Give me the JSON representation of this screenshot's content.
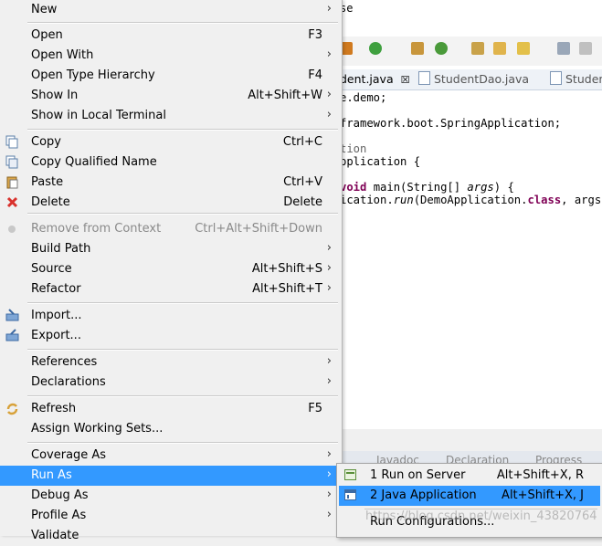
{
  "editor": {
    "partial_text_top": "se",
    "tabs": [
      {
        "label": "dent.java",
        "close": "☒"
      },
      {
        "label": "StudentDao.java"
      },
      {
        "label": "Studen"
      }
    ],
    "code_lines": [
      {
        "segs": [
          {
            "t": "e.demo;"
          }
        ]
      },
      {
        "segs": [
          {
            "t": "framework.boot.SpringApplication;"
          }
        ]
      },
      {
        "segs": [
          {
            "t": "tion",
            "c": "an"
          }
        ]
      },
      {
        "segs": [
          {
            "t": "pplication {"
          }
        ]
      },
      {
        "segs": [
          {
            "t": "void",
            "c": "kw"
          },
          {
            "t": " main(String[] "
          },
          {
            "t": "args",
            "c": "it"
          },
          {
            "t": ") {"
          }
        ]
      },
      {
        "segs": [
          {
            "t": "ication."
          },
          {
            "t": "run",
            "c": "it"
          },
          {
            "t": "(DemoApplication."
          },
          {
            "t": "class",
            "c": "kw"
          },
          {
            "t": ", args);"
          }
        ]
      }
    ],
    "bottom_tabs": [
      "Javadoc",
      "Declaration",
      "Progress"
    ]
  },
  "menu": {
    "items": [
      {
        "label": "New",
        "submenu": true
      },
      {
        "label": "Open",
        "shortcut": "F3"
      },
      {
        "label": "Open With",
        "submenu": true
      },
      {
        "label": "Open Type Hierarchy",
        "shortcut": "F4"
      },
      {
        "label": "Show In",
        "shortcut": "Alt+Shift+W",
        "submenu": true
      },
      {
        "label": "Show in Local Terminal",
        "submenu": true
      },
      {
        "label": "Copy",
        "shortcut": "Ctrl+C",
        "icon": "copy-icon"
      },
      {
        "label": "Copy Qualified Name",
        "icon": "copy-qualified-icon"
      },
      {
        "label": "Paste",
        "shortcut": "Ctrl+V",
        "icon": "paste-icon"
      },
      {
        "label": "Delete",
        "shortcut": "Delete",
        "icon": "delete-icon"
      },
      {
        "label": "Remove from Context",
        "shortcut": "Ctrl+Alt+Shift+Down",
        "disabled": true,
        "icon": "remove-context-icon"
      },
      {
        "label": "Build Path",
        "submenu": true
      },
      {
        "label": "Source",
        "shortcut": "Alt+Shift+S",
        "submenu": true
      },
      {
        "label": "Refactor",
        "shortcut": "Alt+Shift+T",
        "submenu": true
      },
      {
        "label": "Import...",
        "icon": "import-icon"
      },
      {
        "label": "Export...",
        "icon": "export-icon"
      },
      {
        "label": "References",
        "submenu": true
      },
      {
        "label": "Declarations",
        "submenu": true
      },
      {
        "label": "Refresh",
        "shortcut": "F5",
        "icon": "refresh-icon"
      },
      {
        "label": "Assign Working Sets..."
      },
      {
        "label": "Coverage As",
        "submenu": true
      },
      {
        "label": "Run As",
        "submenu": true,
        "selected": true
      },
      {
        "label": "Debug As",
        "submenu": true
      },
      {
        "label": "Profile As",
        "submenu": true
      },
      {
        "label": "Validate"
      }
    ],
    "submenu_arrow": "›"
  },
  "run_as_submenu": {
    "items": [
      {
        "label": "1 Run on Server",
        "shortcut": "Alt+Shift+X, R",
        "icon": "server-icon"
      },
      {
        "label": "2 Java Application",
        "shortcut": "Alt+Shift+X, J",
        "icon": "java-app-icon",
        "selected": true
      },
      {
        "label": "Run Configurations..."
      }
    ]
  },
  "watermark": "https://blog.csdn.net/weixin_43820764",
  "colors": {
    "selection": "#3399ff",
    "menu_bg": "#f0f0f0",
    "keyword": "#7f0055",
    "delete_red": "#d9322d"
  }
}
